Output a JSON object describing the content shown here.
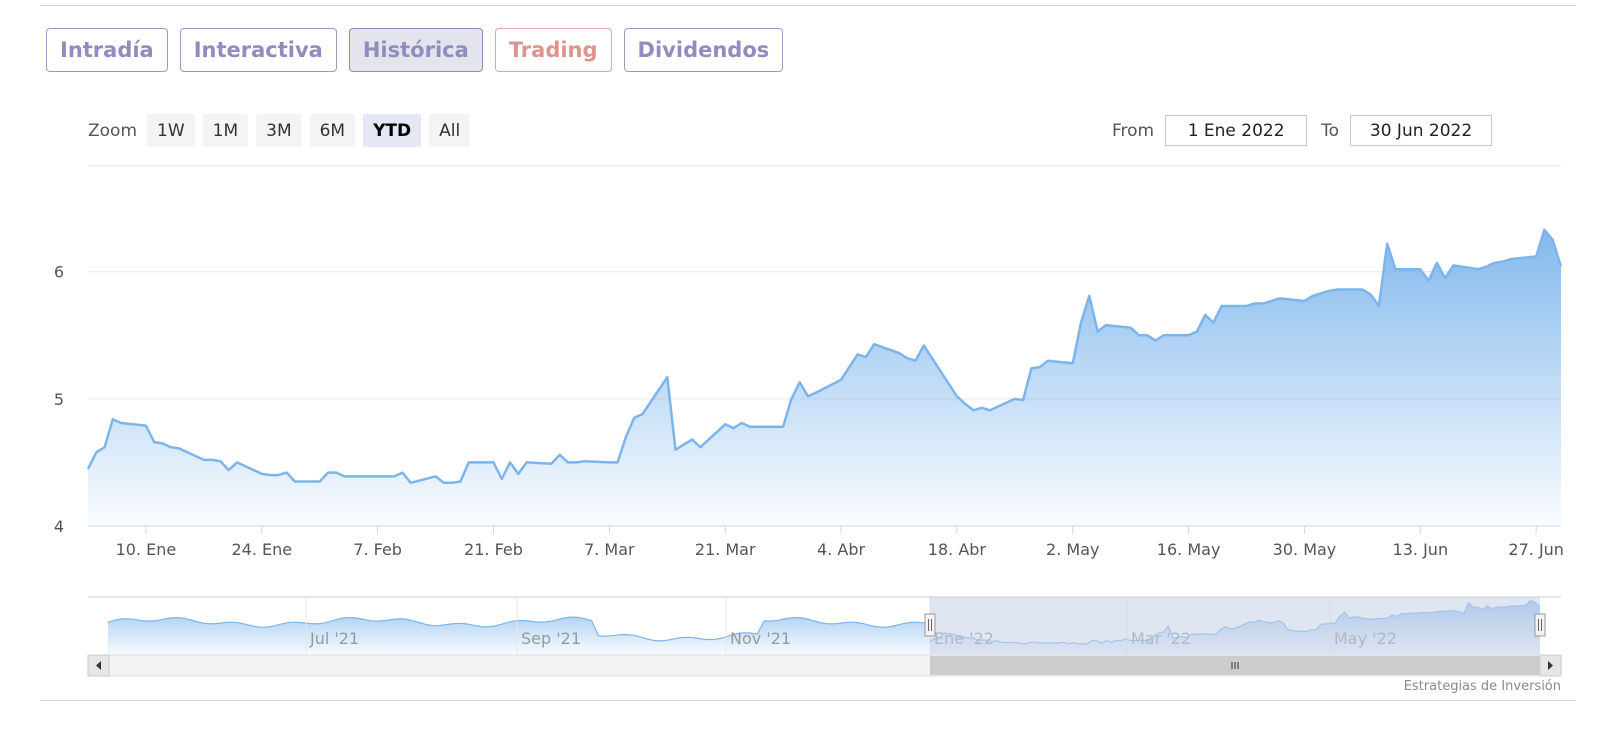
{
  "tabs": [
    {
      "label": "Intradía"
    },
    {
      "label": "Interactiva"
    },
    {
      "label": "Histórica"
    },
    {
      "label": "Trading"
    },
    {
      "label": "Dividendos"
    }
  ],
  "active_tab": "Histórica",
  "zoom": {
    "label": "Zoom",
    "buttons": [
      "1W",
      "1M",
      "3M",
      "6M",
      "YTD",
      "All"
    ],
    "selected": "YTD"
  },
  "range": {
    "from_label": "From",
    "from_value": "1 Ene 2022",
    "to_label": "To",
    "to_value": "30 Jun 2022"
  },
  "credit": "Estrategias de Inversión",
  "colors": {
    "series_line": "#7cb5ec",
    "tab_text": "#8f8cbf",
    "trading_text": "#e0938c",
    "navigator_mask": "#c6d0e8"
  },
  "chart_data": {
    "type": "area",
    "title": "",
    "xlabel": "",
    "ylabel": "",
    "ylim": [
      4,
      6.8
    ],
    "y_ticks": [
      4,
      5,
      6
    ],
    "x_range": [
      "2022-01-03",
      "2022-06-30"
    ],
    "x_ticks": [
      {
        "date": "2022-01-10",
        "label": "10. Ene"
      },
      {
        "date": "2022-01-24",
        "label": "24. Ene"
      },
      {
        "date": "2022-02-07",
        "label": "7. Feb"
      },
      {
        "date": "2022-02-21",
        "label": "21. Feb"
      },
      {
        "date": "2022-03-07",
        "label": "7. Mar"
      },
      {
        "date": "2022-03-21",
        "label": "21. Mar"
      },
      {
        "date": "2022-04-04",
        "label": "4. Abr"
      },
      {
        "date": "2022-04-18",
        "label": "18. Abr"
      },
      {
        "date": "2022-05-02",
        "label": "2. May"
      },
      {
        "date": "2022-05-16",
        "label": "16. May"
      },
      {
        "date": "2022-05-30",
        "label": "30. May"
      },
      {
        "date": "2022-06-13",
        "label": "13. Jun"
      },
      {
        "date": "2022-06-27",
        "label": "27. Jun"
      }
    ],
    "grid": true,
    "series": [
      {
        "x": [
          "2022-01-03",
          "2022-01-04",
          "2022-01-05",
          "2022-01-06",
          "2022-01-07",
          "2022-01-10",
          "2022-01-11",
          "2022-01-12",
          "2022-01-13",
          "2022-01-14",
          "2022-01-17",
          "2022-01-18",
          "2022-01-19",
          "2022-01-20",
          "2022-01-21",
          "2022-01-24",
          "2022-01-25",
          "2022-01-26",
          "2022-01-27",
          "2022-01-28",
          "2022-01-31",
          "2022-02-01",
          "2022-02-02",
          "2022-02-03",
          "2022-02-04",
          "2022-02-07",
          "2022-02-08",
          "2022-02-09",
          "2022-02-10",
          "2022-02-11",
          "2022-02-14",
          "2022-02-15",
          "2022-02-16",
          "2022-02-17",
          "2022-02-18",
          "2022-02-21",
          "2022-02-22",
          "2022-02-23",
          "2022-02-24",
          "2022-02-25",
          "2022-02-28",
          "2022-03-01",
          "2022-03-02",
          "2022-03-03",
          "2022-03-04",
          "2022-03-07",
          "2022-03-08",
          "2022-03-09",
          "2022-03-10",
          "2022-03-11",
          "2022-03-14",
          "2022-03-15",
          "2022-03-16",
          "2022-03-17",
          "2022-03-18",
          "2022-03-21",
          "2022-03-22",
          "2022-03-23",
          "2022-03-24",
          "2022-03-25",
          "2022-03-28",
          "2022-03-29",
          "2022-03-30",
          "2022-03-31",
          "2022-04-01",
          "2022-04-04",
          "2022-04-05",
          "2022-04-06",
          "2022-04-07",
          "2022-04-08",
          "2022-04-11",
          "2022-04-12",
          "2022-04-13",
          "2022-04-14",
          "2022-04-15",
          "2022-04-18",
          "2022-04-19",
          "2022-04-20",
          "2022-04-21",
          "2022-04-22",
          "2022-04-25",
          "2022-04-26",
          "2022-04-27",
          "2022-04-28",
          "2022-04-29",
          "2022-05-02",
          "2022-05-03",
          "2022-05-04",
          "2022-05-05",
          "2022-05-06",
          "2022-05-09",
          "2022-05-10",
          "2022-05-11",
          "2022-05-12",
          "2022-05-13",
          "2022-05-16",
          "2022-05-17",
          "2022-05-18",
          "2022-05-19",
          "2022-05-20",
          "2022-05-23",
          "2022-05-24",
          "2022-05-25",
          "2022-05-26",
          "2022-05-27",
          "2022-05-30",
          "2022-05-31",
          "2022-06-01",
          "2022-06-02",
          "2022-06-03",
          "2022-06-06",
          "2022-06-07",
          "2022-06-08",
          "2022-06-09",
          "2022-06-10",
          "2022-06-13",
          "2022-06-14",
          "2022-06-15",
          "2022-06-16",
          "2022-06-17",
          "2022-06-20",
          "2022-06-21",
          "2022-06-22",
          "2022-06-23",
          "2022-06-24",
          "2022-06-27",
          "2022-06-28",
          "2022-06-29",
          "2022-06-30"
        ],
        "y": [
          4.45,
          4.58,
          4.62,
          4.84,
          4.81,
          4.79,
          4.66,
          4.65,
          4.62,
          4.61,
          4.52,
          4.52,
          4.51,
          4.44,
          4.5,
          4.41,
          4.4,
          4.4,
          4.42,
          4.35,
          4.35,
          4.42,
          4.42,
          4.39,
          4.39,
          4.39,
          4.39,
          4.39,
          4.42,
          4.34,
          4.39,
          4.34,
          4.34,
          4.35,
          4.5,
          4.5,
          4.37,
          4.5,
          4.41,
          4.5,
          4.49,
          4.56,
          4.5,
          4.5,
          4.51,
          4.5,
          4.5,
          4.7,
          4.85,
          4.88,
          5.17,
          4.6,
          4.64,
          4.68,
          4.62,
          4.8,
          4.77,
          4.81,
          4.78,
          4.78,
          4.78,
          5.0,
          5.13,
          5.02,
          5.05,
          5.15,
          5.25,
          5.35,
          5.33,
          5.43,
          5.36,
          5.32,
          5.3,
          5.42,
          5.32,
          5.02,
          4.96,
          4.91,
          4.93,
          4.91,
          5.0,
          4.99,
          5.24,
          5.25,
          5.3,
          5.28,
          5.6,
          5.81,
          5.53,
          5.58,
          5.56,
          5.5,
          5.5,
          5.46,
          5.5,
          5.5,
          5.53,
          5.66,
          5.6,
          5.73,
          5.73,
          5.75,
          5.75,
          5.77,
          5.79,
          5.77,
          5.81,
          5.83,
          5.85,
          5.86,
          5.86,
          5.82,
          5.73,
          6.22,
          6.02,
          6.02,
          5.93,
          6.07,
          5.95,
          6.05,
          6.02,
          6.04,
          6.07,
          6.08,
          6.1,
          6.12,
          6.33,
          6.25,
          6.04
        ]
      }
    ],
    "navigator": {
      "x_labels": [
        "Jul '21",
        "Sep '21",
        "Nov '21",
        "Ene '22",
        "Mar '22",
        "May '22"
      ],
      "selected_range": [
        "2022-01-03",
        "2022-06-30"
      ]
    }
  }
}
